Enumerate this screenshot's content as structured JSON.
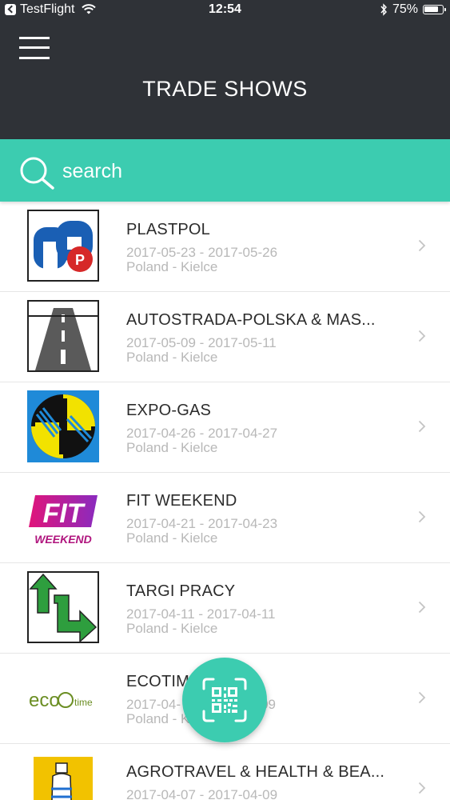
{
  "status_bar": {
    "carrier": "TestFlight",
    "time": "12:54",
    "battery": "75%"
  },
  "header": {
    "title": "TRADE SHOWS"
  },
  "search": {
    "placeholder": "search"
  },
  "shows": [
    {
      "name": "PLASTPOL",
      "dates": "2017-05-23 - 2017-05-26",
      "location": "Poland - Kielce",
      "logo": "plastpol-logo"
    },
    {
      "name": "AUTOSTRADA-POLSKA & MAS...",
      "dates": "2017-05-09 - 2017-05-11",
      "location": "Poland - Kielce",
      "logo": "autostrada-logo"
    },
    {
      "name": "EXPO-GAS",
      "dates": "2017-04-26 - 2017-04-27",
      "location": "Poland - Kielce",
      "logo": "expo-gas-logo"
    },
    {
      "name": "FIT WEEKEND",
      "dates": "2017-04-21 - 2017-04-23",
      "location": "Poland - Kielce",
      "logo": "fit-weekend-logo",
      "logo_text_1": "FIT",
      "logo_text_2": "WEEKEND"
    },
    {
      "name": "TARGI PRACY",
      "dates": "2017-04-11 - 2017-04-11",
      "location": "Poland - Kielce",
      "logo": "targi-pracy-logo"
    },
    {
      "name": "ECOTIM",
      "dates": "2017-04-",
      "dates_tail": "09",
      "location": "Poland - K",
      "logo": "ecotime-logo",
      "logo_text_1": "eco",
      "logo_text_2": "time"
    },
    {
      "name": "AGROTRAVEL & HEALTH & BEA...",
      "dates": "2017-04-07 - 2017-04-09",
      "location": "",
      "logo": "agrotravel-logo"
    }
  ],
  "icons": {
    "menu": "hamburger-icon",
    "search": "search-icon",
    "chevron": "chevron-right-icon",
    "fab": "qr-code-icon"
  },
  "colors": {
    "header": "#2f3237",
    "accent": "#3cccb0",
    "text": "#2c2c2c",
    "subtext": "#b8b8b8"
  }
}
